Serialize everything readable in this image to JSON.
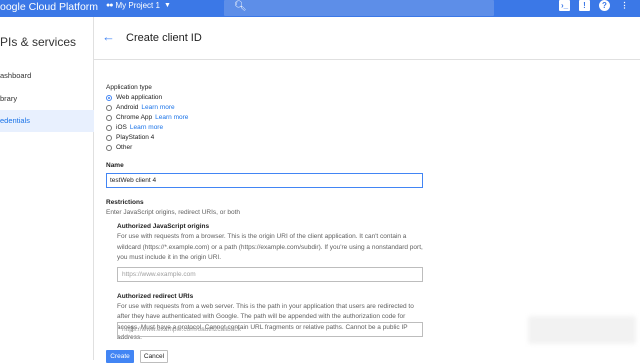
{
  "topbar": {
    "brand": "oogle Cloud Platform",
    "project": "My Project 1"
  },
  "sidebar": {
    "title": "PIs & services",
    "items": [
      {
        "label": "ashboard"
      },
      {
        "label": "brary"
      },
      {
        "label": "edentials"
      }
    ]
  },
  "header": {
    "title": "Create client ID"
  },
  "form": {
    "app_type_label": "Application type",
    "app_types": [
      {
        "label": "Web application",
        "link": ""
      },
      {
        "label": "Android",
        "link": "Learn more"
      },
      {
        "label": "Chrome App",
        "link": "Learn more"
      },
      {
        "label": "iOS",
        "link": "Learn more"
      },
      {
        "label": "PlayStation 4",
        "link": ""
      },
      {
        "label": "Other",
        "link": ""
      }
    ],
    "name_label": "Name",
    "name_value": "testWeb client 4",
    "restrictions_label": "Restrictions",
    "restrictions_help": "Enter JavaScript origins, redirect URIs, or both",
    "origins_label": "Authorized JavaScript origins",
    "origins_help": "For use with requests from a browser. This is the origin URI of the client application. It can't contain a wildcard (https://*.example.com) or a path (https://example.com/subdir). If you're using a nonstandard port, you must include it in the origin URI.",
    "origins_placeholder": "https://www.example.com",
    "redirect_label": "Authorized redirect URIs",
    "redirect_help": "For use with requests from a web server. This is the path in your application that users are redirected to after they have authenticated with Google. The path will be appended with the authorization code for access. Must have a protocol. Cannot contain URL fragments or relative paths. Cannot be a public IP address.",
    "redirect_placeholder": "https://www.example.com/oauth2callback",
    "create_label": "Create",
    "cancel_label": "Cancel"
  }
}
